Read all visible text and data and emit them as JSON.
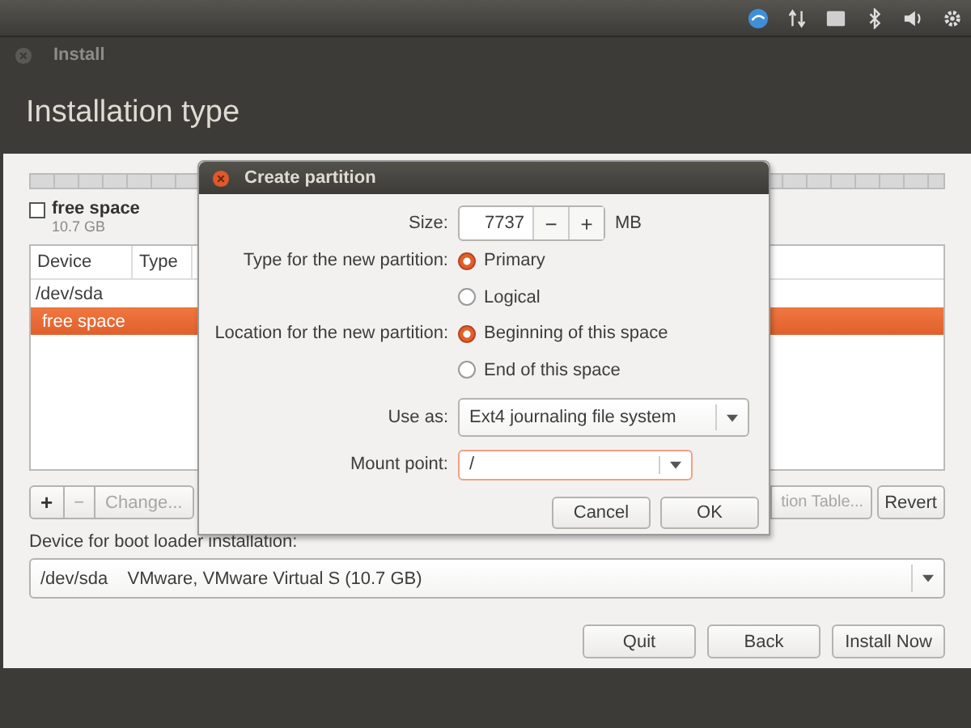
{
  "window": {
    "title": "Install",
    "heading": "Installation type"
  },
  "partition_legend": {
    "label": "free space",
    "size": "10.7 GB",
    "checked": false
  },
  "table": {
    "columns": [
      "Device",
      "Type"
    ],
    "rows": [
      {
        "device": "/dev/sda",
        "selected": false
      },
      {
        "device": "free space",
        "selected": true
      }
    ]
  },
  "table_buttons": [
    {
      "label": "+",
      "disabled": false
    },
    {
      "label": "−",
      "disabled": true
    },
    {
      "label": "Change...",
      "disabled": true
    }
  ],
  "right_buttons": [
    {
      "label": "tion Table...",
      "disabled": true
    },
    {
      "label": "Revert",
      "disabled": false
    }
  ],
  "boot_loader": {
    "label": "Device for boot loader installation:",
    "device": "/dev/sda",
    "description": "VMware, VMware Virtual S (10.7 GB)"
  },
  "nav_buttons": [
    "Quit",
    "Back",
    "Install Now"
  ],
  "dialog": {
    "title": "Create partition",
    "size": {
      "label": "Size:",
      "value": "7737",
      "decrement": "−",
      "increment": "+",
      "unit": "MB"
    },
    "groups": [
      {
        "label": "Type for the new partition:",
        "options": [
          {
            "label": "Primary",
            "selected": true
          },
          {
            "label": "Logical",
            "selected": false
          }
        ]
      },
      {
        "label": "Location for the new partition:",
        "options": [
          {
            "label": "Beginning of this space",
            "selected": true
          },
          {
            "label": "End of this space",
            "selected": false
          }
        ]
      }
    ],
    "use_as": {
      "label": "Use as:",
      "value": "Ext4 journaling file system"
    },
    "mount_point": {
      "label": "Mount point:",
      "value": "/"
    },
    "buttons": [
      "Cancel",
      "OK"
    ]
  }
}
